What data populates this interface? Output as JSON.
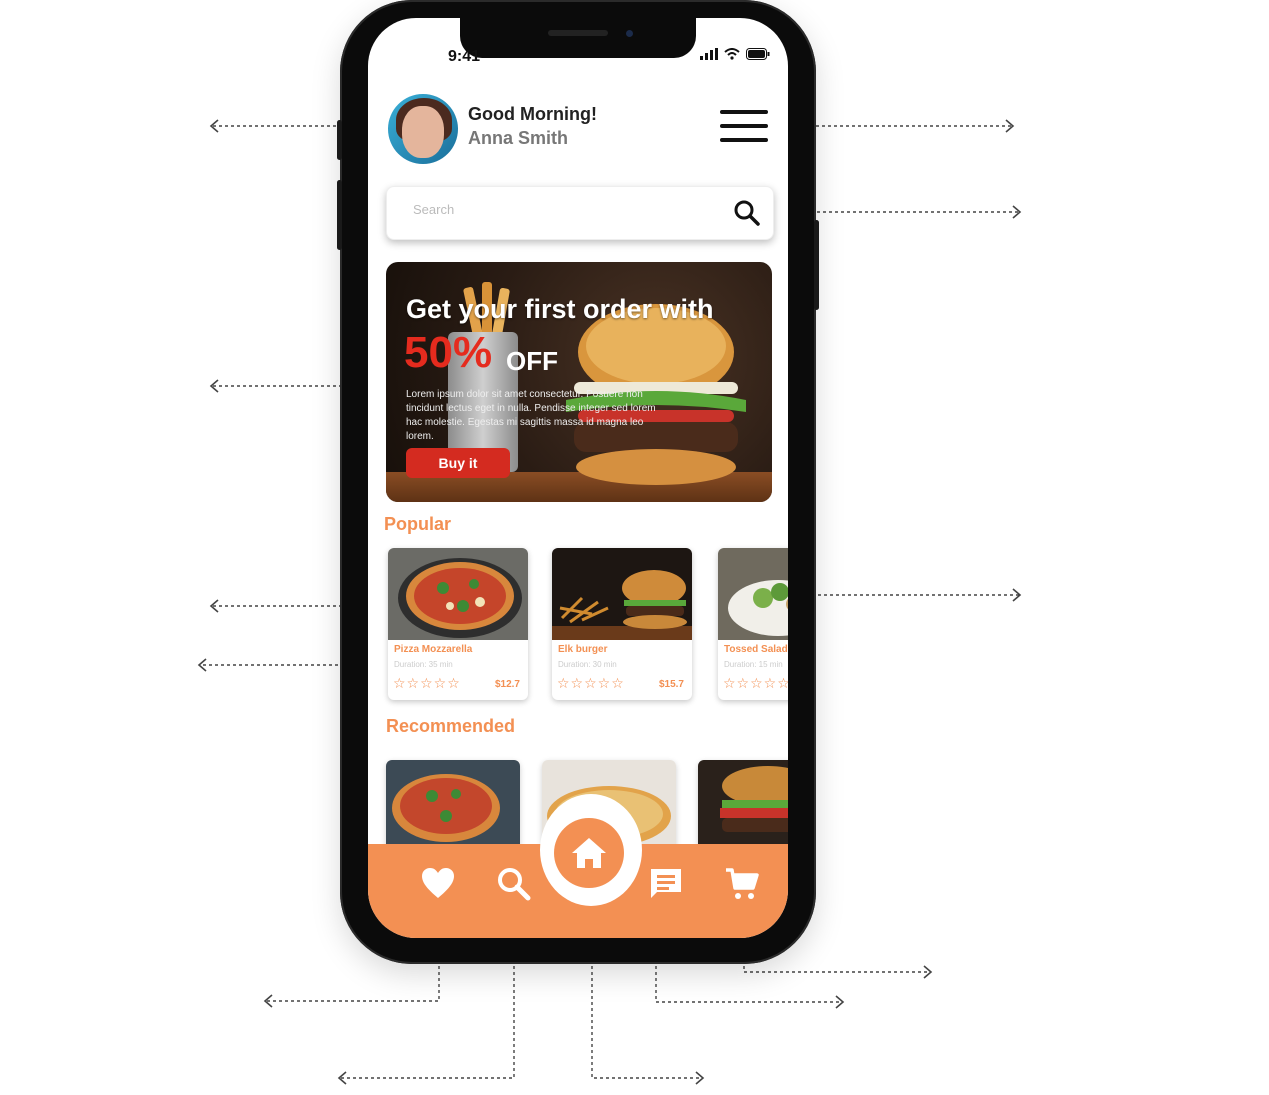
{
  "status_bar": {
    "time": "9:41"
  },
  "header": {
    "greeting": "Good Morning!",
    "user_name": "Anna Smith"
  },
  "search": {
    "placeholder": "Search"
  },
  "promo": {
    "title": "Get your first order with",
    "percent": "50%",
    "off": "OFF",
    "body": "Lorem ipsum dolor sit amet consectetur. Posuere non tincidunt lectus eget in nulla. Pendisse integer sed lorem hac molestie. Egestas mi sagittis massa id magna leo lorem.",
    "button_label": "Buy it"
  },
  "popular": {
    "title": "Popular",
    "items": [
      {
        "name": "Pizza Mozzarella",
        "duration": "Duration: 35 min",
        "stars": "☆☆☆☆☆",
        "price": "$12.7"
      },
      {
        "name": "Elk burger",
        "duration": "Duration: 30 min",
        "stars": "☆☆☆☆☆",
        "price": "$15.7"
      },
      {
        "name": "Tossed Salad",
        "duration": "Duration: 15 min",
        "stars": "☆☆☆☆☆",
        "price": ""
      }
    ]
  },
  "recommended": {
    "title": "Recommended"
  },
  "nav": {
    "items": [
      "heart-icon",
      "search-icon",
      "home-icon",
      "chat-icon",
      "cart-icon"
    ],
    "active": "home-icon"
  },
  "colors": {
    "accent": "#f39053",
    "promo_red": "#e52b1e",
    "button_red": "#d42b20"
  }
}
